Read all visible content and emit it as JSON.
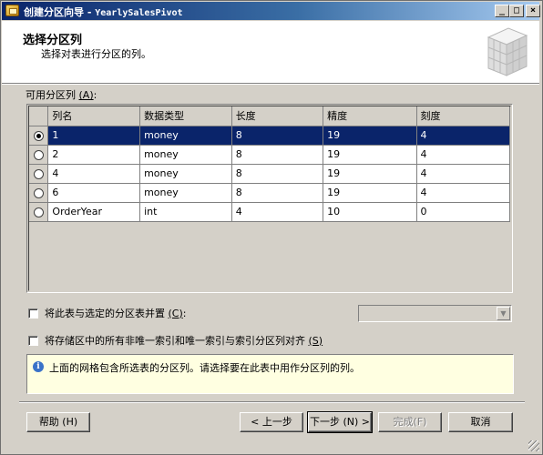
{
  "window": {
    "title_prefix": "创建分区向导 - ",
    "title_object": "YearlySalesPivot",
    "buttons": {
      "minimize": "_",
      "maximize": "□",
      "close": "×"
    }
  },
  "header": {
    "title": "选择分区列",
    "subtitle": "选择对表进行分区的列。"
  },
  "columns_section": {
    "label": "可用分区列",
    "label_mnemonic": "(A)",
    "label_suffix": ":"
  },
  "grid": {
    "headers": [
      "列名",
      "数据类型",
      "长度",
      "精度",
      "刻度"
    ],
    "rows": [
      {
        "selected": true,
        "name": "1",
        "type": "money",
        "length": "8",
        "precision": "19",
        "scale": "4"
      },
      {
        "selected": false,
        "name": "2",
        "type": "money",
        "length": "8",
        "precision": "19",
        "scale": "4"
      },
      {
        "selected": false,
        "name": "4",
        "type": "money",
        "length": "8",
        "precision": "19",
        "scale": "4"
      },
      {
        "selected": false,
        "name": "6",
        "type": "money",
        "length": "8",
        "precision": "19",
        "scale": "4"
      },
      {
        "selected": false,
        "name": "OrderYear",
        "type": "int",
        "length": "4",
        "precision": "10",
        "scale": "0"
      }
    ]
  },
  "collocate": {
    "label": "将此表与选定的分区表并置",
    "mnemonic": "(C)",
    "suffix": ":",
    "checked": false,
    "combo_value": ""
  },
  "storage_align": {
    "label": "将存储区中的所有非唯一索引和唯一索引与索引分区列对齐",
    "mnemonic": "(S)",
    "checked": false
  },
  "info": {
    "icon": "info-icon",
    "text": "上面的网格包含所选表的分区列。请选择要在此表中用作分区列的列。"
  },
  "buttons": {
    "help": "帮助 (H)",
    "back": "< 上一步",
    "next": "下一步 (N) >",
    "finish": "完成(F)",
    "cancel": "取消"
  },
  "colors": {
    "title_active": "#0a246a",
    "selection": "#0a246a",
    "face": "#d4d0c8",
    "info_bg": "#ffffe1"
  }
}
